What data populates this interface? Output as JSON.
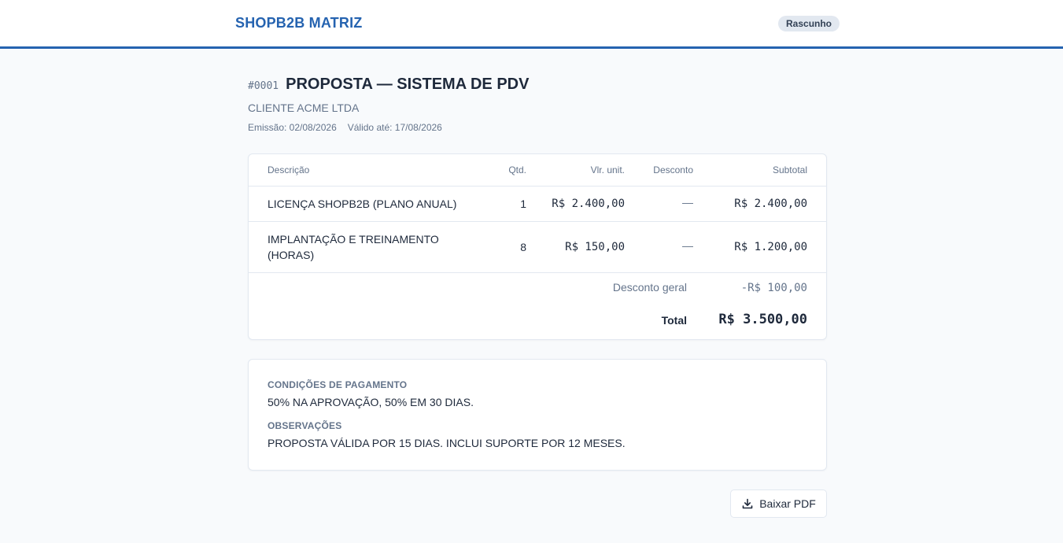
{
  "topbar": {
    "brand": "SHOPB2B MATRIZ",
    "status_badge": "Rascunho"
  },
  "document": {
    "number": "#0001",
    "title": "PROPOSTA — SISTEMA DE PDV",
    "client": "CLIENTE ACME LTDA",
    "issue_date": "Emissão: 02/08/2026",
    "valid_until": "Válido até: 17/08/2026"
  },
  "items_table": {
    "columns": {
      "description": "Descrição",
      "qty": "Qtd.",
      "unit_price": "Vlr. unit.",
      "discount": "Desconto",
      "subtotal": "Subtotal"
    },
    "rows": [
      {
        "description": "LICENÇA SHOPB2B (PLANO ANUAL)",
        "qty": "1",
        "unit_price": "R$ 2.400,00",
        "discount": "—",
        "subtotal": "R$ 2.400,00"
      },
      {
        "description": "IMPLANTAÇÃO E TREINAMENTO (HORAS)",
        "qty": "8",
        "unit_price": "R$ 150,00",
        "discount": "—",
        "subtotal": "R$ 1.200,00"
      }
    ],
    "general_discount_label": "Desconto geral",
    "general_discount_value": "-R$ 100,00",
    "total_label": "Total",
    "total_value": "R$ 3.500,00"
  },
  "terms": {
    "payment_label": "CONDIÇÕES DE PAGAMENTO",
    "payment_text": "50% NA APROVAÇÃO, 50% EM 30 DIAS.",
    "notes_label": "OBSERVAÇÕES",
    "notes_text": "PROPOSTA VÁLIDA POR 15 DIAS. INCLUI SUPORTE POR 12 MESES."
  },
  "actions": {
    "download_pdf": "Baixar PDF",
    "download_icon": "download-icon"
  },
  "colors": {
    "accent": "#2563b0",
    "muted_text": "#64748b",
    "border": "#e2e8f0",
    "badge_bg": "#e2e8f0"
  }
}
